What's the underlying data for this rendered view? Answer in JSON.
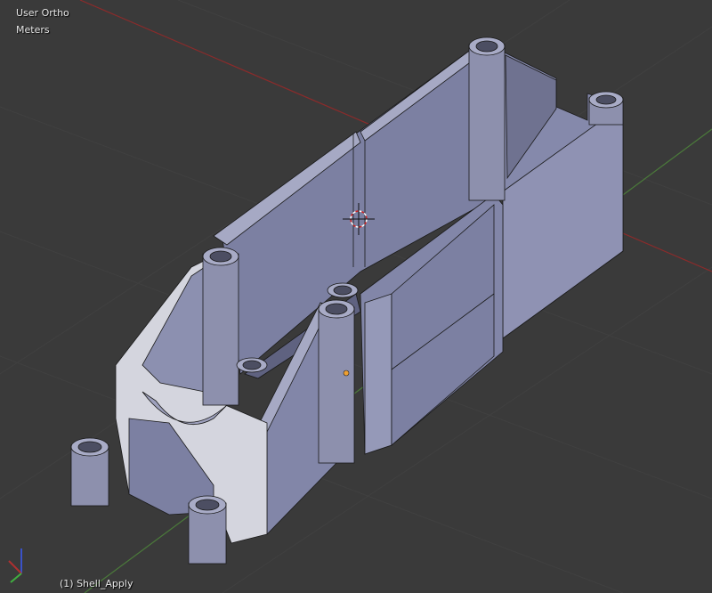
{
  "viewport": {
    "view_name": "User Ortho",
    "units": "Meters",
    "object_info": "(1) Shell_Apply"
  },
  "colors": {
    "background": "#3a3a3a",
    "x_axis": "#8a2b2b",
    "y_axis": "#4b7a3a",
    "mesh_face": "#8286a8",
    "mesh_face_dark": "#6c6f8c",
    "mesh_face_light": "#c9cad6",
    "origin": "#f0a030"
  },
  "icons": [
    "axis-gizmo-icon",
    "3d-cursor-icon",
    "object-origin-icon"
  ]
}
